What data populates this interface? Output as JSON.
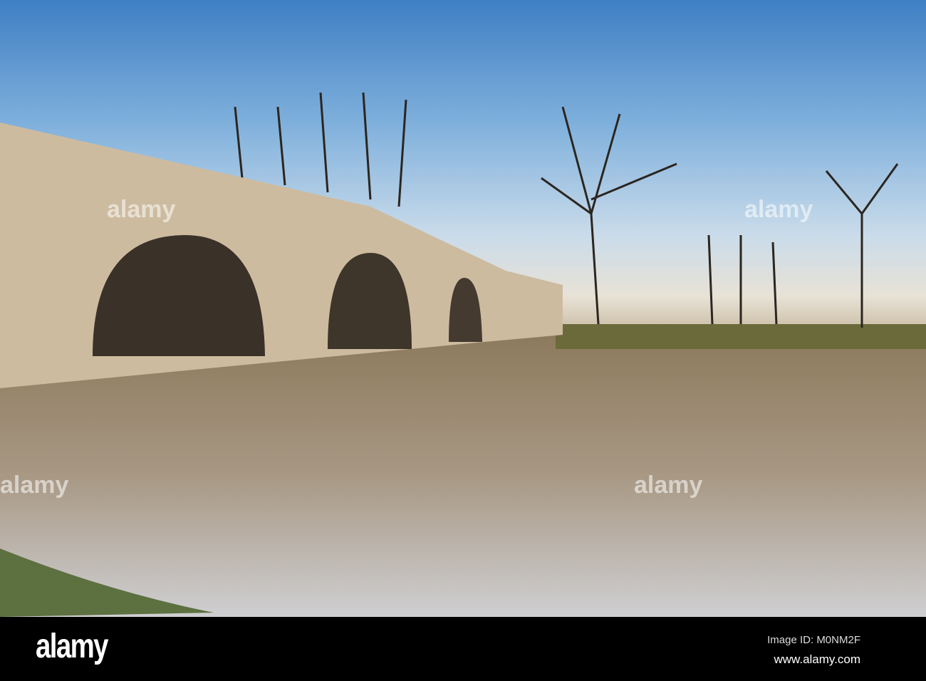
{
  "photo": {
    "subject": "Stone arched bridge over a river with bare trees"
  },
  "watermark": "alamy",
  "footer": {
    "logo": "alamy",
    "image_id": "Image ID: M0NM2F",
    "url": "www.alamy.com"
  }
}
